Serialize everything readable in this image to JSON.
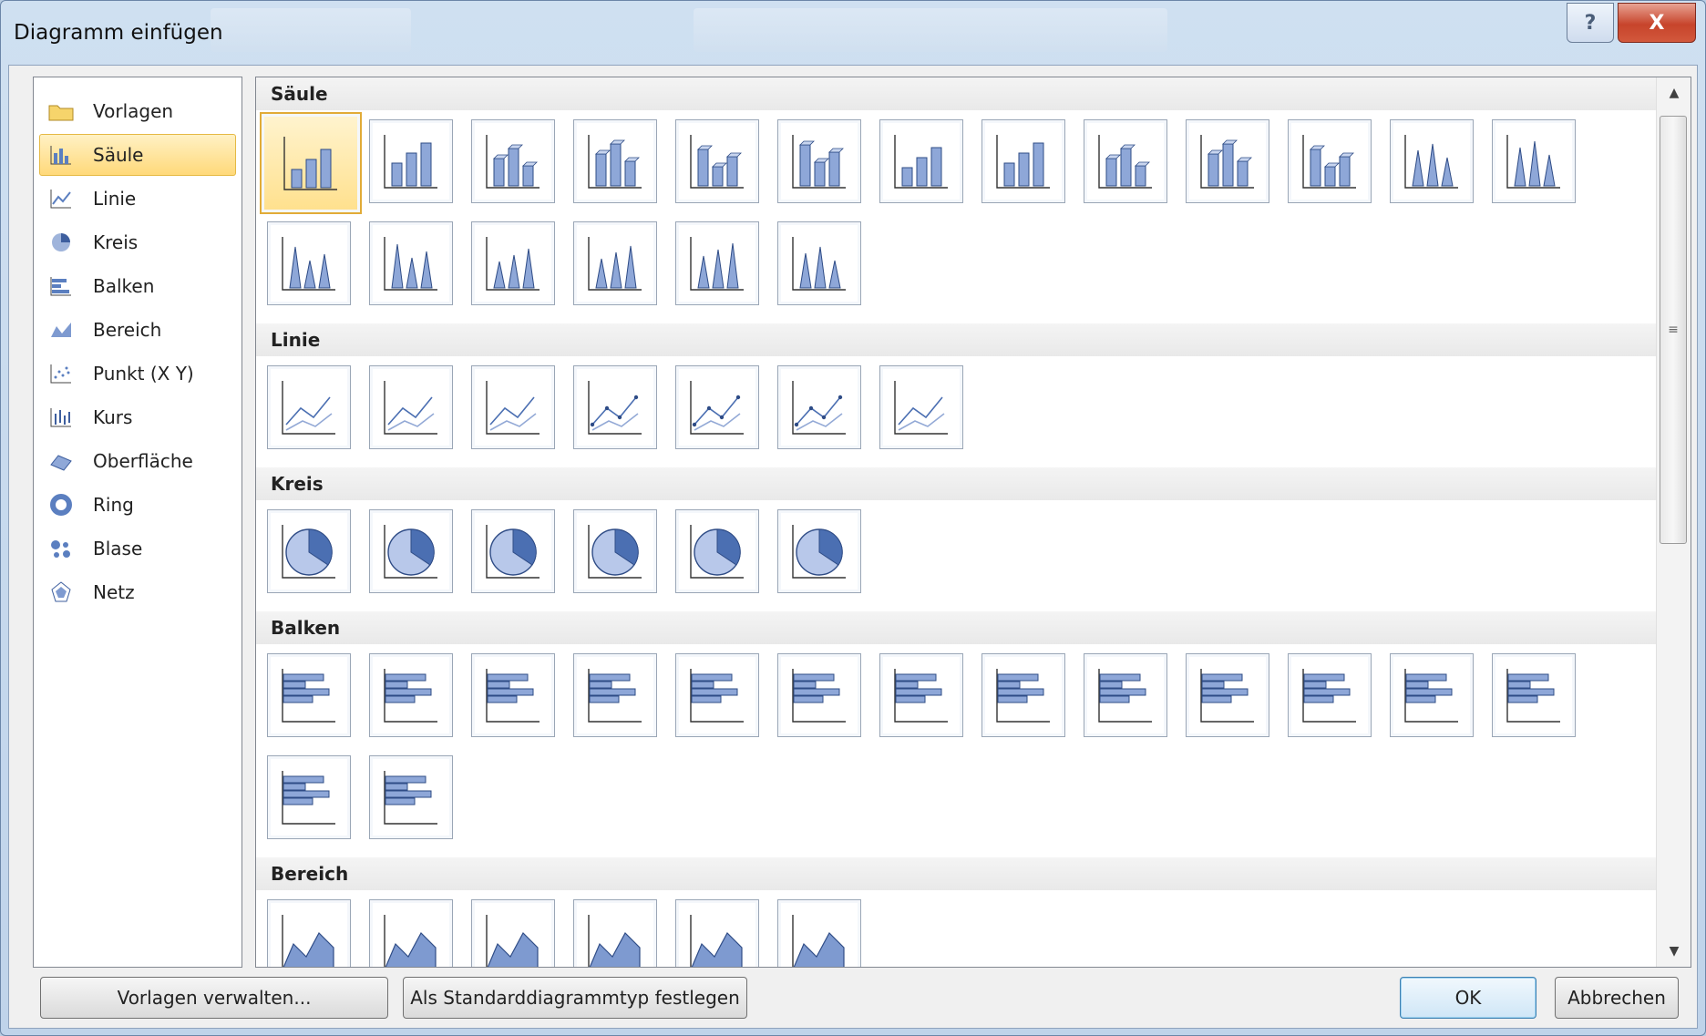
{
  "window": {
    "title": "Diagramm einfügen",
    "help_glyph": "?",
    "close_glyph": "X"
  },
  "sidebar": {
    "items": [
      {
        "label": "Vorlagen",
        "icon": "folder-icon"
      },
      {
        "label": "Säule",
        "icon": "column-chart-icon",
        "selected": true
      },
      {
        "label": "Linie",
        "icon": "line-chart-icon"
      },
      {
        "label": "Kreis",
        "icon": "pie-chart-icon"
      },
      {
        "label": "Balken",
        "icon": "bar-chart-icon"
      },
      {
        "label": "Bereich",
        "icon": "area-chart-icon"
      },
      {
        "label": "Punkt (X Y)",
        "icon": "scatter-chart-icon"
      },
      {
        "label": "Kurs",
        "icon": "stock-chart-icon"
      },
      {
        "label": "Oberfläche",
        "icon": "surface-chart-icon"
      },
      {
        "label": "Ring",
        "icon": "doughnut-chart-icon"
      },
      {
        "label": "Blase",
        "icon": "bubble-chart-icon"
      },
      {
        "label": "Netz",
        "icon": "radar-chart-icon"
      }
    ]
  },
  "gallery": {
    "sections": [
      {
        "label": "Säule",
        "rows": [
          13,
          6
        ],
        "kind": "column"
      },
      {
        "label": "Linie",
        "rows": [
          7
        ],
        "kind": "line"
      },
      {
        "label": "Kreis",
        "rows": [
          6
        ],
        "kind": "pie"
      },
      {
        "label": "Balken",
        "rows": [
          13,
          2
        ],
        "kind": "bar"
      },
      {
        "label": "Bereich",
        "rows": [
          6
        ],
        "kind": "area"
      }
    ],
    "selected_section": "Säule",
    "selected_index": 0
  },
  "buttons": {
    "manage_templates": "Vorlagen verwalten...",
    "set_default": "Als Standarddiagrammtyp festlegen",
    "ok": "OK",
    "cancel": "Abbrechen"
  },
  "colors": {
    "accent": "#5b7fc0",
    "selection": "#ffd97a"
  }
}
